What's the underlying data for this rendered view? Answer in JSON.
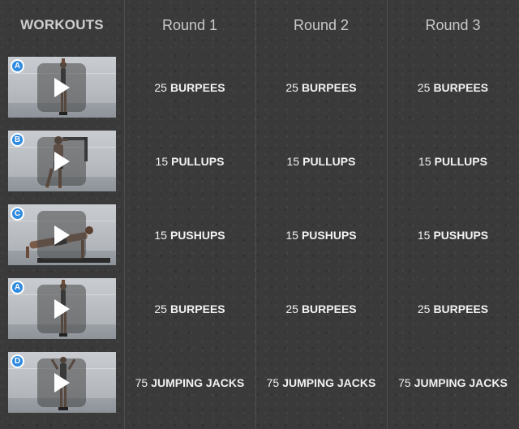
{
  "header": {
    "workouts_label": "WORKOUTS",
    "rounds": [
      "Round 1",
      "Round 2",
      "Round 3"
    ]
  },
  "rows": [
    {
      "badge": "A",
      "exercise": "burpees",
      "cells": [
        {
          "count": "25",
          "name": "BURPEES"
        },
        {
          "count": "25",
          "name": "BURPEES"
        },
        {
          "count": "25",
          "name": "BURPEES"
        }
      ]
    },
    {
      "badge": "B",
      "exercise": "pullups",
      "cells": [
        {
          "count": "15",
          "name": "PULLUPS"
        },
        {
          "count": "15",
          "name": "PULLUPS"
        },
        {
          "count": "15",
          "name": "PULLUPS"
        }
      ]
    },
    {
      "badge": "C",
      "exercise": "pushups",
      "cells": [
        {
          "count": "15",
          "name": "PUSHUPS"
        },
        {
          "count": "15",
          "name": "PUSHUPS"
        },
        {
          "count": "15",
          "name": "PUSHUPS"
        }
      ]
    },
    {
      "badge": "A",
      "exercise": "burpees",
      "cells": [
        {
          "count": "25",
          "name": "BURPEES"
        },
        {
          "count": "25",
          "name": "BURPEES"
        },
        {
          "count": "25",
          "name": "BURPEES"
        }
      ]
    },
    {
      "badge": "D",
      "exercise": "jumping-jacks",
      "cells": [
        {
          "count": "75",
          "name": "JUMPING JACKS"
        },
        {
          "count": "75",
          "name": "JUMPING JACKS"
        },
        {
          "count": "75",
          "name": "JUMPING JACKS"
        }
      ]
    }
  ],
  "icons": {
    "play": "play-icon"
  },
  "colors": {
    "badge": "#2f8be0",
    "background": "#3a3a3a"
  }
}
